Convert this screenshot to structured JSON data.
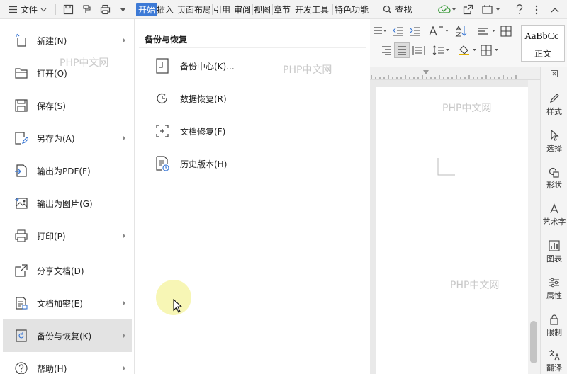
{
  "toolbar": {
    "file_menu_label": "文件",
    "tabs": [
      "开始",
      "插入",
      "页面布局",
      "引用",
      "审阅",
      "视图",
      "章节",
      "开发工具",
      "特色功能"
    ],
    "active_tab": "开始",
    "search_label": "查找"
  },
  "file_menu": {
    "items": [
      {
        "label": "新建(N)",
        "icon": "new-file-icon",
        "has_submenu": true
      },
      {
        "label": "打开(O)",
        "icon": "folder-open-icon",
        "has_submenu": false
      },
      {
        "label": "保存(S)",
        "icon": "save-icon",
        "has_submenu": false
      },
      {
        "label": "另存为(A)",
        "icon": "save-as-icon",
        "has_submenu": true
      },
      {
        "label": "输出为PDF(F)",
        "icon": "export-pdf-icon",
        "has_submenu": false
      },
      {
        "label": "输出为图片(G)",
        "icon": "export-image-icon",
        "has_submenu": false
      },
      {
        "label": "打印(P)",
        "icon": "print-icon",
        "has_submenu": true
      },
      {
        "label": "分享文档(D)",
        "icon": "share-icon",
        "has_submenu": false
      },
      {
        "label": "文档加密(E)",
        "icon": "encrypt-icon",
        "has_submenu": true
      },
      {
        "label": "备份与恢复(K)",
        "icon": "backup-icon",
        "has_submenu": true
      },
      {
        "label": "帮助(H)",
        "icon": "help-icon",
        "has_submenu": true
      }
    ],
    "active_item": "备份与恢复(K)"
  },
  "submenu": {
    "title": "备份与恢复",
    "items": [
      {
        "label": "备份中心(K)...",
        "icon": "backup-center-icon"
      },
      {
        "label": "数据恢复(R)",
        "icon": "data-recovery-icon"
      },
      {
        "label": "文档修复(F)",
        "icon": "doc-repair-icon"
      },
      {
        "label": "历史版本(H)",
        "icon": "history-version-icon"
      }
    ]
  },
  "ribbon": {
    "style_preview_text": "AaBbCc",
    "style_name": "正文"
  },
  "right_panel": {
    "items": [
      "样式",
      "选择",
      "形状",
      "艺术字",
      "图表",
      "属性",
      "限制",
      "翻译"
    ]
  },
  "watermark_text": "PHP中文网",
  "colors": {
    "active_tab_bg": "#3d7ad6",
    "menu_hover_bg": "#e3e3e3",
    "cursor_highlight": "#f0ee78"
  }
}
